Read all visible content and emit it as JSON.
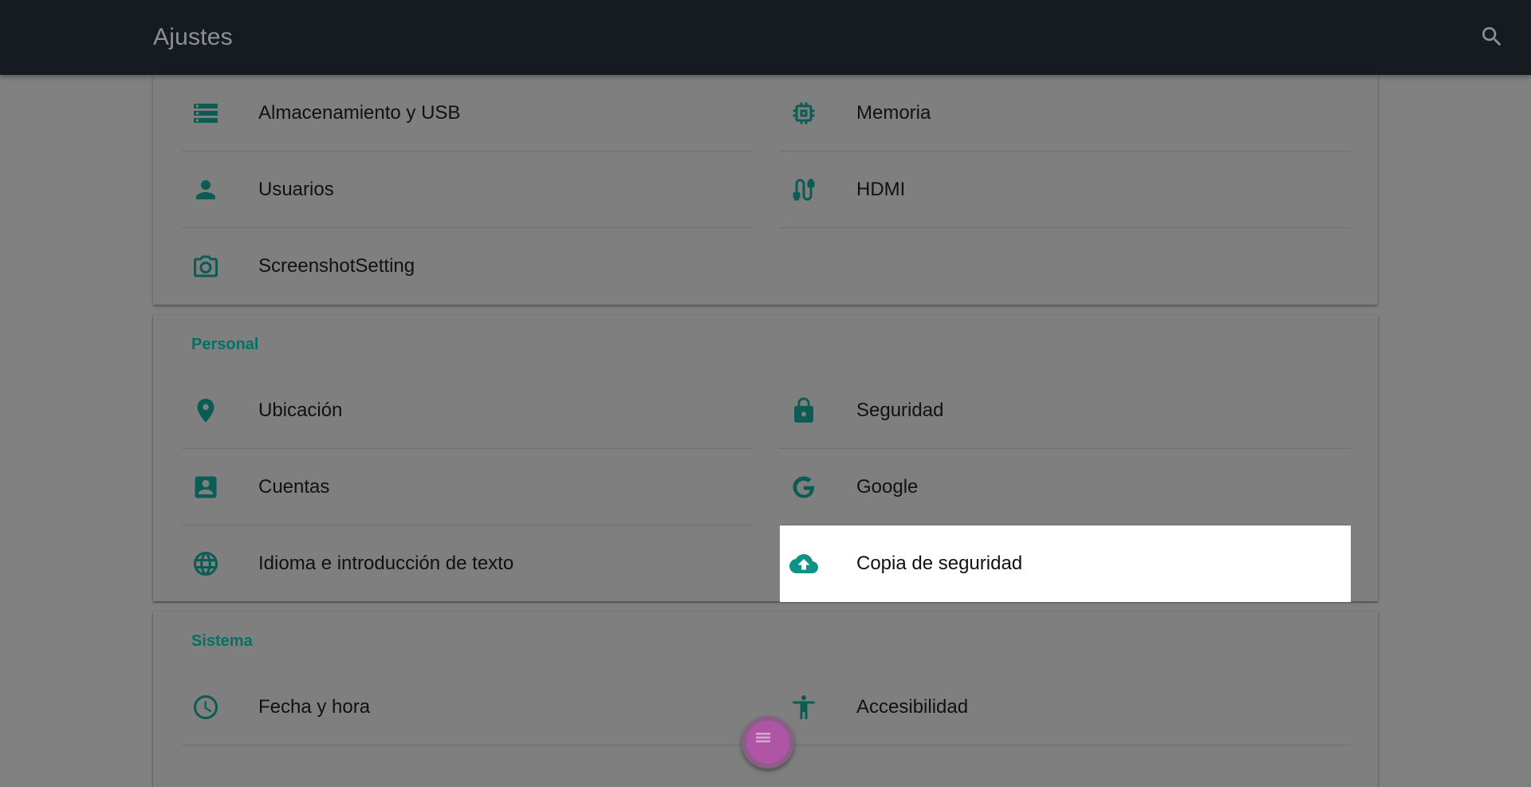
{
  "appbar": {
    "title": "Ajustes",
    "search_icon": "search-icon"
  },
  "device": {
    "items": [
      {
        "label": "Almacenamiento y USB",
        "icon": "storage-icon"
      },
      {
        "label": "Memoria",
        "icon": "memory-icon"
      },
      {
        "label": "Usuarios",
        "icon": "person-icon"
      },
      {
        "label": "HDMI",
        "icon": "cable-icon"
      },
      {
        "label": "ScreenshotSetting",
        "icon": "camera-icon"
      }
    ]
  },
  "personal": {
    "header": "Personal",
    "items": [
      {
        "label": "Ubicación",
        "icon": "location-pin-icon"
      },
      {
        "label": "Seguridad",
        "icon": "lock-icon"
      },
      {
        "label": "Cuentas",
        "icon": "account-box-icon"
      },
      {
        "label": "Google",
        "icon": "google-icon"
      },
      {
        "label": "Idioma e introducción de texto",
        "icon": "globe-icon"
      },
      {
        "label": "Copia de seguridad",
        "icon": "cloud-upload-icon",
        "focused": true
      }
    ]
  },
  "system": {
    "header": "Sistema",
    "items": [
      {
        "label": "Fecha y hora",
        "icon": "clock-icon"
      },
      {
        "label": "Accesibilidad",
        "icon": "accessibility-icon"
      }
    ]
  },
  "fab": {
    "icon": "menu-icon"
  },
  "colors": {
    "appbar_bg": "#151b21",
    "accent_teal": "#007266",
    "dim_background": "#808080",
    "focused_bg": "#ffffff",
    "fab": "#b055a6"
  }
}
